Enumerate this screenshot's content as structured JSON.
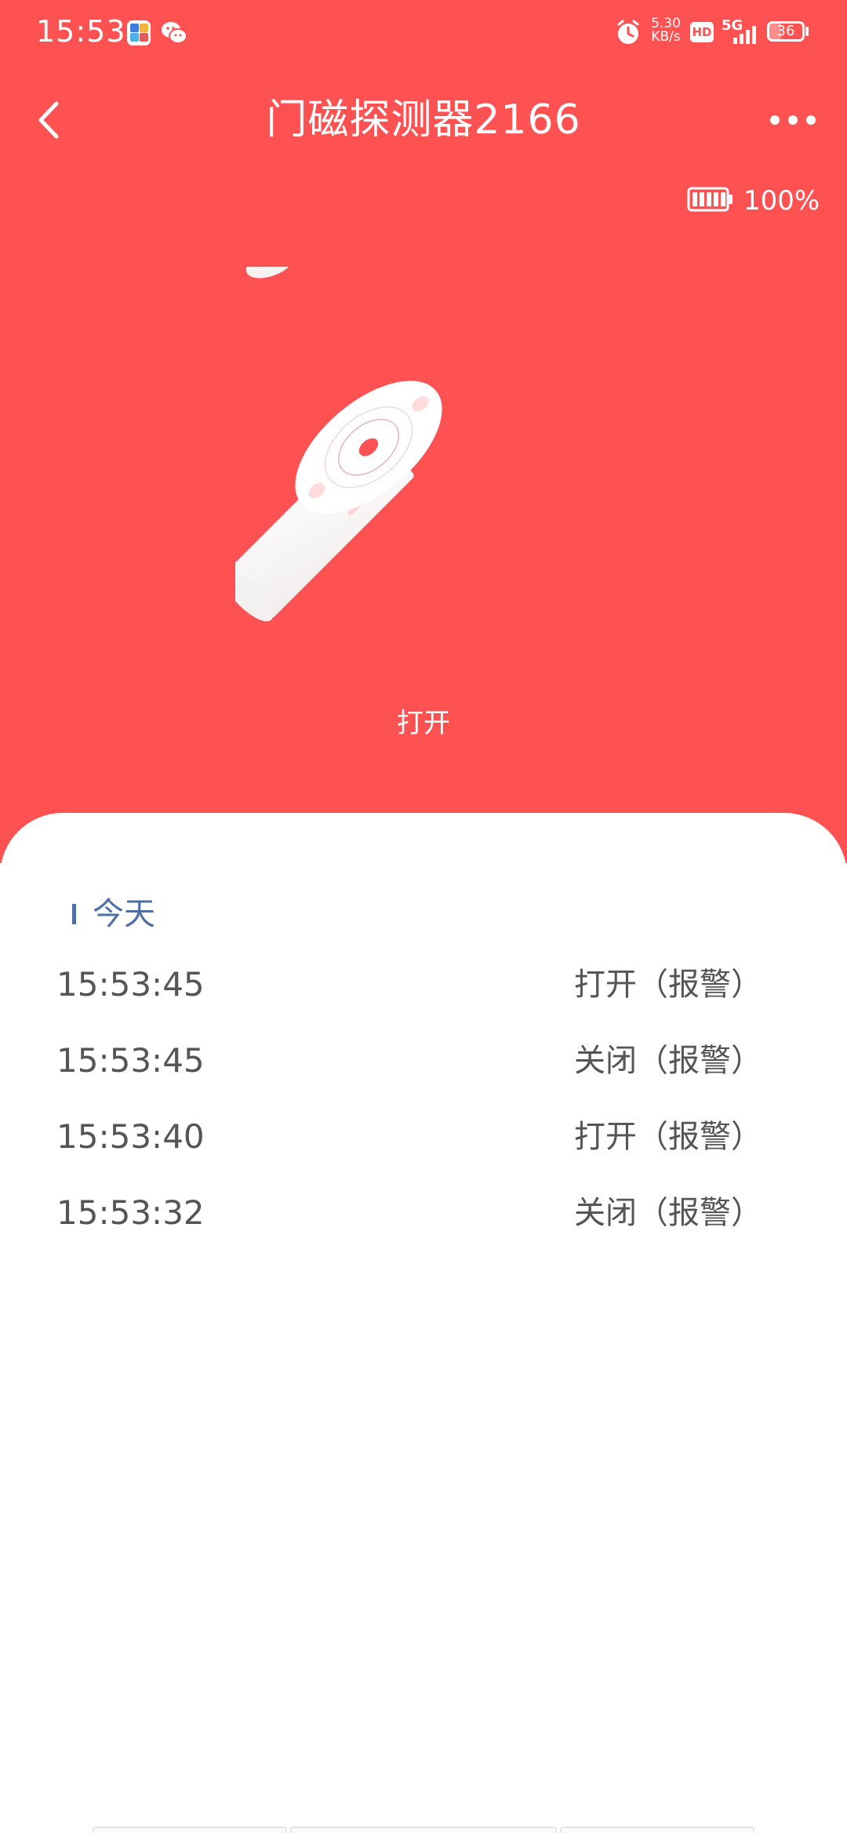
{
  "status_bar": {
    "time": "15:53",
    "net_speed_value": "5.30",
    "net_speed_unit": "KB/s",
    "hd_label": "HD",
    "network_type": "5G",
    "battery_level": "36",
    "battery_fraction": 0.36,
    "icons": [
      "app-notification-icon",
      "wechat-icon",
      "alarm-icon",
      "hd-icon",
      "signal-icon",
      "battery-icon"
    ]
  },
  "header": {
    "title": "门磁探测器2166",
    "back_icon": "chevron-left-icon",
    "more_icon": "more-dots-icon"
  },
  "device": {
    "battery_text": "100%",
    "battery_fraction": 1.0,
    "state_label": "打开"
  },
  "history": {
    "section_label": "今天",
    "rows": [
      {
        "time": "15:53:45",
        "status": "打开（报警）"
      },
      {
        "time": "15:53:45",
        "status": "关闭（报警）"
      },
      {
        "time": "15:53:40",
        "status": "打开（报警）"
      },
      {
        "time": "15:53:32",
        "status": "关闭（报警）"
      }
    ]
  },
  "colors": {
    "hero_background": "#fe5151",
    "card_background": "#ffffff",
    "section_accent": "#4e6fa6",
    "row_text": "#555555"
  }
}
